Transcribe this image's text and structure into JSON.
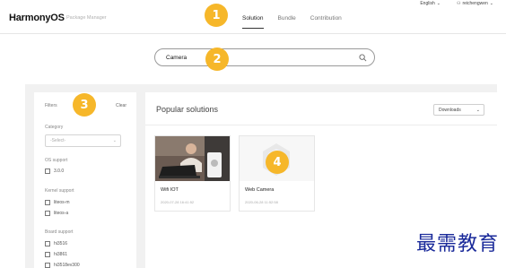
{
  "topbar": {
    "language": "English",
    "user": "reichengwen"
  },
  "header": {
    "logo": "HarmonyOS",
    "subtitle": "Package Manager",
    "tabs": [
      "Solution",
      "Bundle",
      "Contribution"
    ],
    "active_tab": "Solution"
  },
  "search": {
    "value": "Camera"
  },
  "filters": {
    "title": "Filters",
    "clear": "Clear",
    "category_label": "Category",
    "category_placeholder": "-Select-",
    "os_support_label": "OS support",
    "os_options": [
      "3.0.0"
    ],
    "kernel_support_label": "Kernel support",
    "kernel_options": [
      "liteos-m",
      "liteos-a"
    ],
    "board_support_label": "Board support",
    "board_options": [
      "hi3516",
      "hi3861",
      "hi3518ev300"
    ]
  },
  "main": {
    "title": "Popular solutions",
    "sort": "Downloads",
    "cards": [
      {
        "name": "Wifi IOT",
        "date": "2020-07-28 16:41:52"
      },
      {
        "name": "Web Camera",
        "date": "2020-06-28 11:52:58"
      }
    ]
  },
  "badges": [
    "1",
    "2",
    "3",
    "4"
  ],
  "watermark": "最需教育",
  "colors": {
    "badge": "#f6b72a",
    "watermark": "#1a2a9a"
  }
}
